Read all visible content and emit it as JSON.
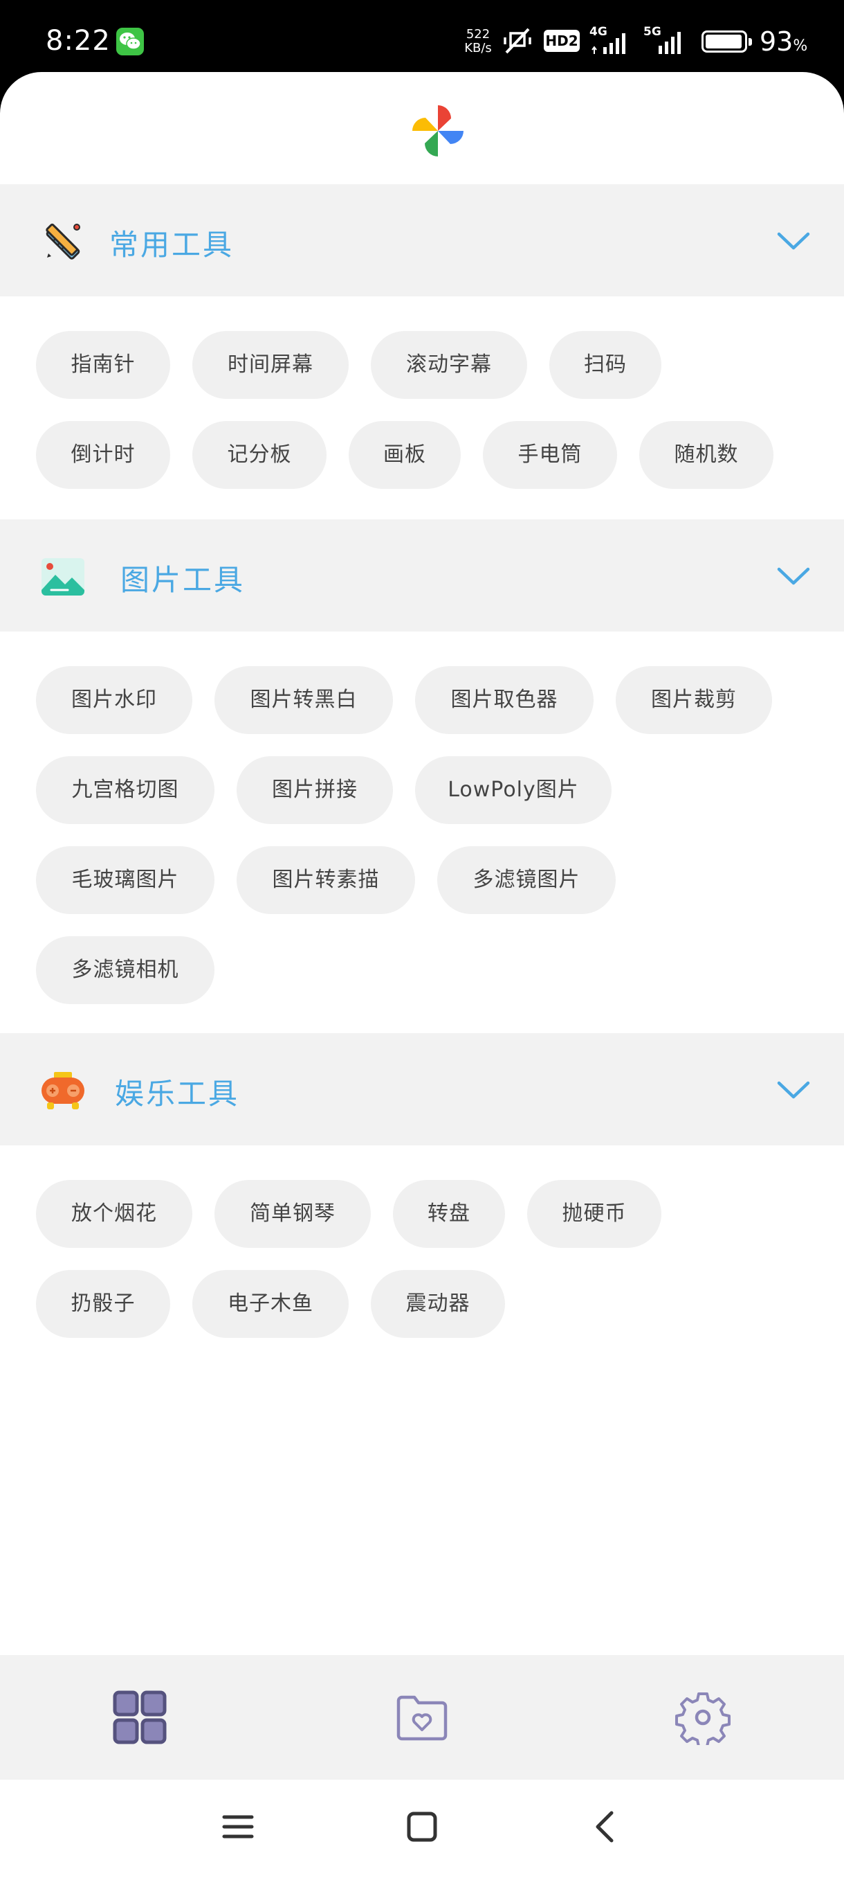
{
  "status_bar": {
    "time": "8:22",
    "net_speed_value": "522",
    "net_speed_unit": "KB/s",
    "hd_label": "HD2",
    "signal_1_label": "4G",
    "signal_2_label": "5G",
    "battery_percent": "93",
    "battery_unit": "%"
  },
  "sections": [
    {
      "title": "常用工具",
      "icon": "tools-icon",
      "tools": [
        "指南针",
        "时间屏幕",
        "滚动字幕",
        "扫码",
        "倒计时",
        "记分板",
        "画板",
        "手电筒",
        "随机数"
      ]
    },
    {
      "title": "图片工具",
      "icon": "picture-icon",
      "tools": [
        "图片水印",
        "图片转黑白",
        "图片取色器",
        "图片裁剪",
        "九宫格切图",
        "图片拼接",
        "LowPoly图片",
        "毛玻璃图片",
        "图片转素描",
        "多滤镜图片",
        "多滤镜相机"
      ]
    },
    {
      "title": "娱乐工具",
      "icon": "game-icon",
      "tools": [
        "放个烟花",
        "简单钢琴",
        "转盘",
        "抛硬币",
        "扔骰子",
        "电子木鱼",
        "震动器"
      ]
    }
  ],
  "bottom_nav": {
    "items": [
      "grid-icon",
      "favorite-folder-icon",
      "settings-gear-icon"
    ],
    "active_index": 0
  },
  "colors": {
    "accent": "#4aa8e3",
    "chip_bg": "#f0f0f0",
    "section_bg": "#f2f2f2",
    "nav_icon": "#8b86b8",
    "nav_icon_active": "#55527e"
  }
}
